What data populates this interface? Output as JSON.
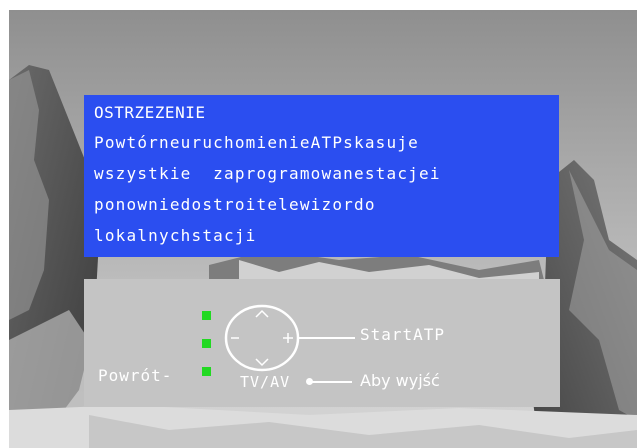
{
  "warning": {
    "title": "OSTRZEZENIE",
    "lines": [
      "PowtórneuruchomienieATPskasuje",
      "wszystkie  zaprogramowanestacjei",
      "ponowniedostroitelewizordo",
      "lokalnychstacji"
    ]
  },
  "controls": {
    "back_label": "Powrót-",
    "start_label": "StartATP",
    "source_label": "TV/AV",
    "exit_label": "Aby wyjść",
    "remote_symbols": {
      "up": "∧",
      "down": "∨",
      "left": "−",
      "right": "+"
    }
  },
  "colors": {
    "warning_background": "#2b4ef0",
    "panel_background": "#c4c4c4",
    "indicator": "#22d922",
    "text": "#ffffff"
  }
}
